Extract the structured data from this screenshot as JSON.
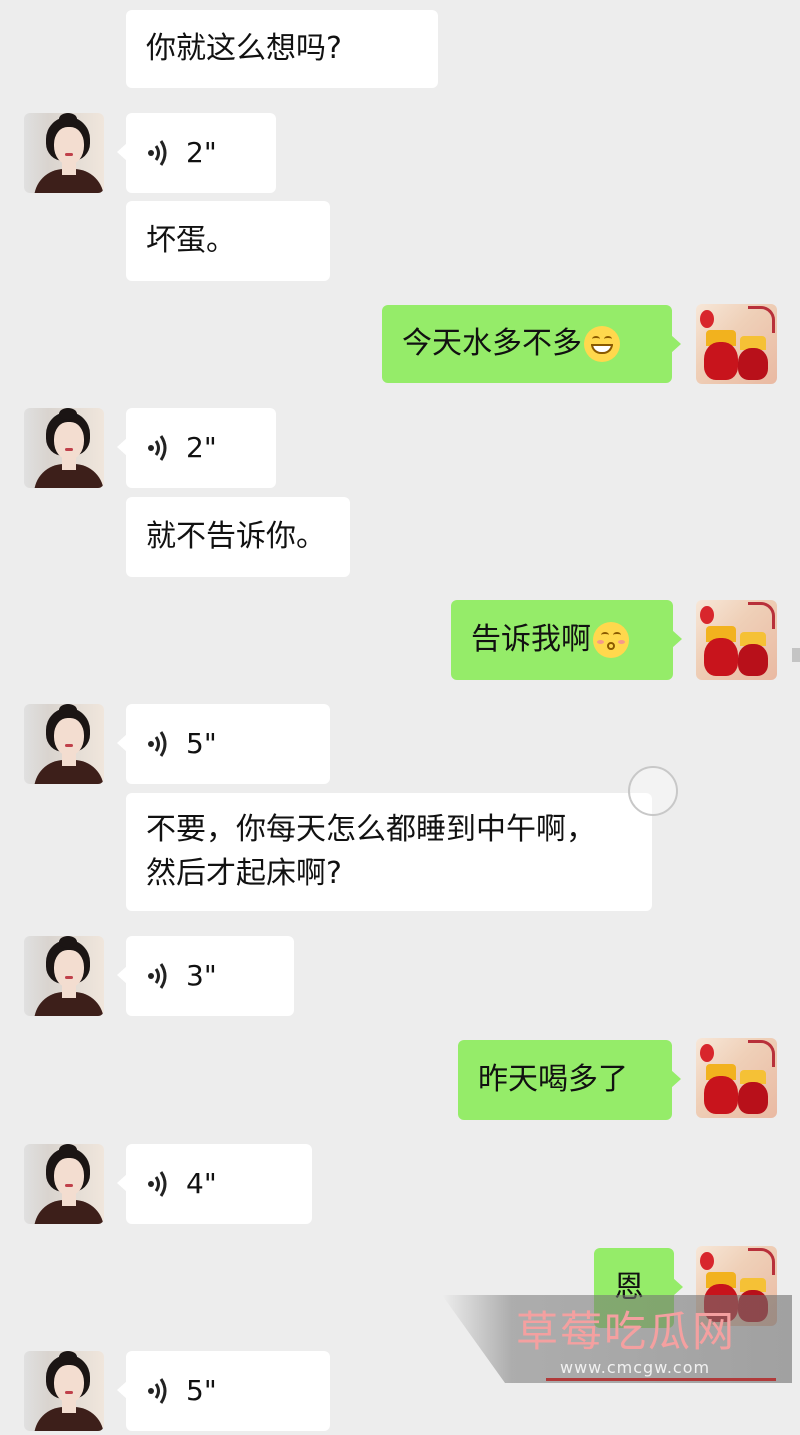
{
  "messages": [
    {
      "side": "in",
      "type": "text",
      "text": "你就这么想吗?"
    },
    {
      "side": "in",
      "type": "voice",
      "duration": "2\""
    },
    {
      "side": "in",
      "type": "text",
      "text": "坏蛋。"
    },
    {
      "side": "out",
      "type": "text",
      "text": "今天水多不多",
      "emoji": "grinning-face-icon"
    },
    {
      "side": "in",
      "type": "voice",
      "duration": "2\""
    },
    {
      "side": "in",
      "type": "text",
      "text": "就不告诉你。"
    },
    {
      "side": "out",
      "type": "text",
      "text": "告诉我啊",
      "emoji": "kissing-face-icon"
    },
    {
      "side": "in",
      "type": "voice",
      "duration": "5\""
    },
    {
      "side": "in",
      "type": "text",
      "text": "不要，你每天怎么都睡到中午啊，\n然后才起床啊?"
    },
    {
      "side": "in",
      "type": "voice",
      "duration": "3\""
    },
    {
      "side": "out",
      "type": "text",
      "text": "昨天喝多了"
    },
    {
      "side": "in",
      "type": "voice",
      "duration": "4\""
    },
    {
      "side": "out",
      "type": "text",
      "text": "恩"
    },
    {
      "side": "in",
      "type": "voice",
      "duration": "5\""
    }
  ],
  "watermark": {
    "title": "草莓吃瓜网",
    "url": "www.cmcgw.com"
  },
  "colors": {
    "background": "#ededed",
    "incoming_bubble": "#ffffff",
    "outgoing_bubble": "#95ec69"
  }
}
